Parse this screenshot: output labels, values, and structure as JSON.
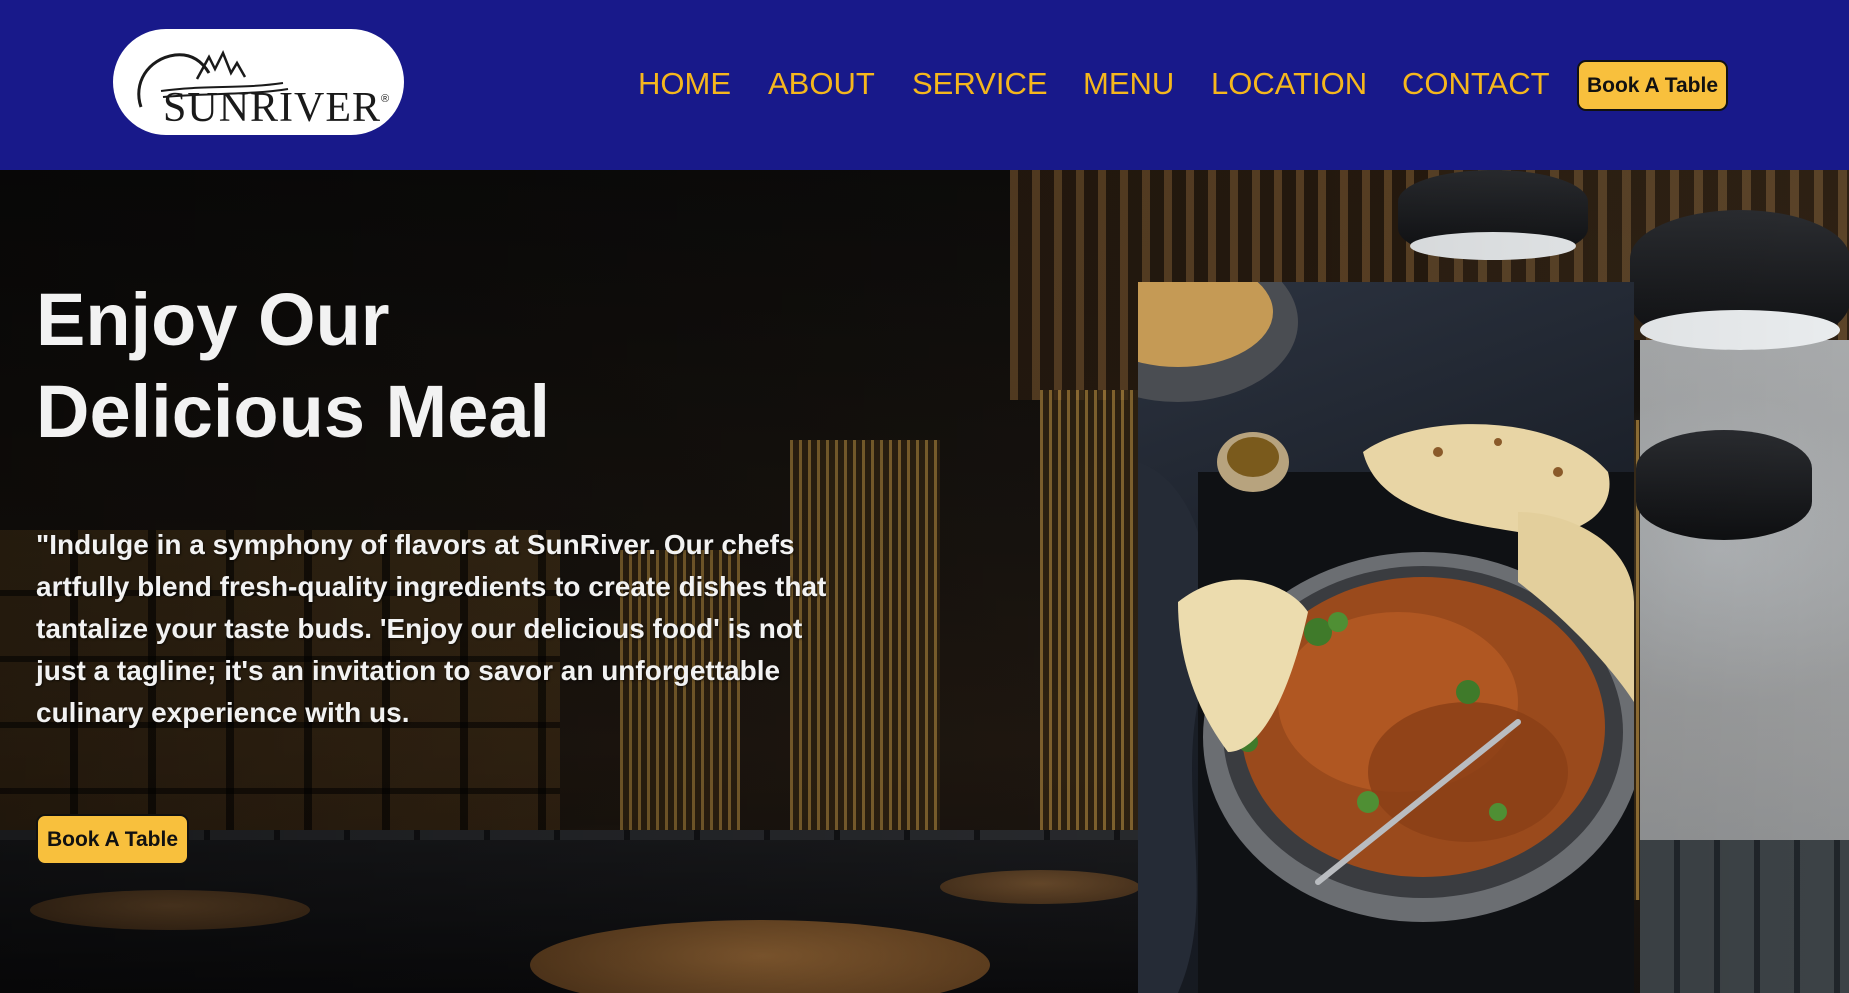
{
  "header": {
    "logo": {
      "wordmark": "SUNRIVER",
      "registered": "®"
    },
    "nav": [
      {
        "label": "HOME"
      },
      {
        "label": "ABOUT"
      },
      {
        "label": "SERVICE"
      },
      {
        "label": "MENU"
      },
      {
        "label": "LOCATION"
      },
      {
        "label": "CONTACT"
      }
    ],
    "cta_label": "Book A Table"
  },
  "hero": {
    "title_line1": "Enjoy Our",
    "title_line2": "Delicious Meal",
    "description_lines": [
      "\"Indulge in a symphony of flavors at SunRiver. Our chefs",
      "artfully blend fresh-quality ingredients to create dishes that",
      "tantalize your taste buds. 'Enjoy our delicious food' is not",
      "just a tagline; it's an invitation to savor an unforgettable",
      "culinary experience with us."
    ],
    "cta_label": "Book A Table"
  },
  "colors": {
    "nav_bg": "#18198a",
    "nav_link": "#f5b71d",
    "button_bg": "#f8c03d",
    "hero_text": "#f2f2f2"
  }
}
